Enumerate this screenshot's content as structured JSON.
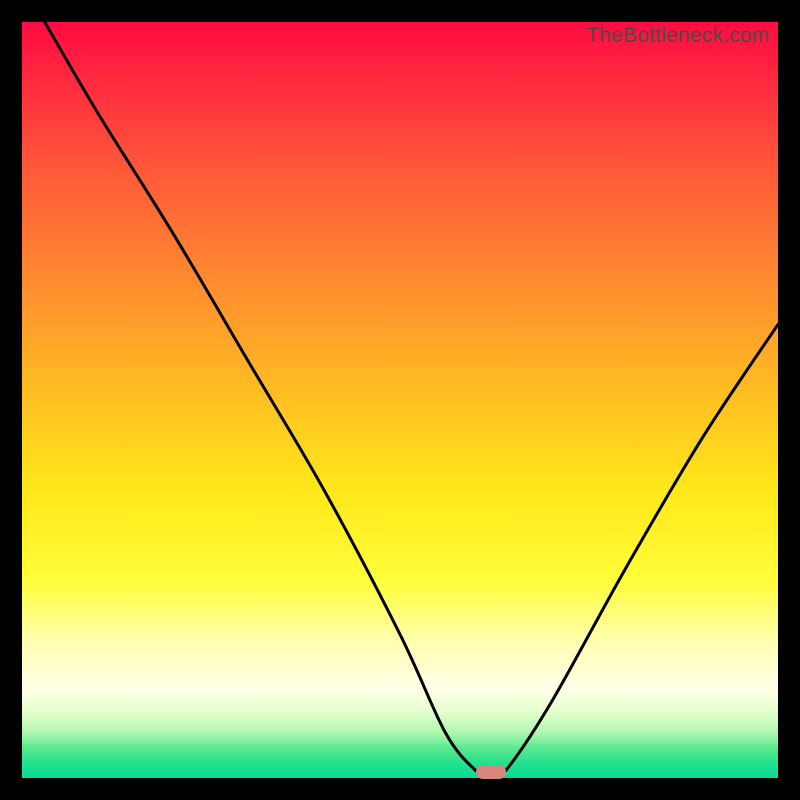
{
  "watermark": "TheBottleneck.com",
  "chart_data": {
    "type": "line",
    "title": "",
    "xlabel": "",
    "ylabel": "",
    "xlim": [
      0,
      100
    ],
    "ylim": [
      0,
      100
    ],
    "grid": false,
    "legend": false,
    "series": [
      {
        "name": "bottleneck-curve",
        "x": [
          3,
          10,
          20,
          30,
          40,
          50,
          56,
          60,
          62,
          64,
          70,
          80,
          90,
          100
        ],
        "y": [
          100,
          88,
          72,
          55,
          38,
          19,
          6,
          1,
          0,
          1,
          10,
          28,
          45,
          60
        ]
      }
    ],
    "marker": {
      "x": 62,
      "y": 0.8
    },
    "colors": {
      "curve": "#000000",
      "marker": "#d9867e",
      "gradient_top": "#ff0b41",
      "gradient_bottom": "#07da97"
    }
  }
}
